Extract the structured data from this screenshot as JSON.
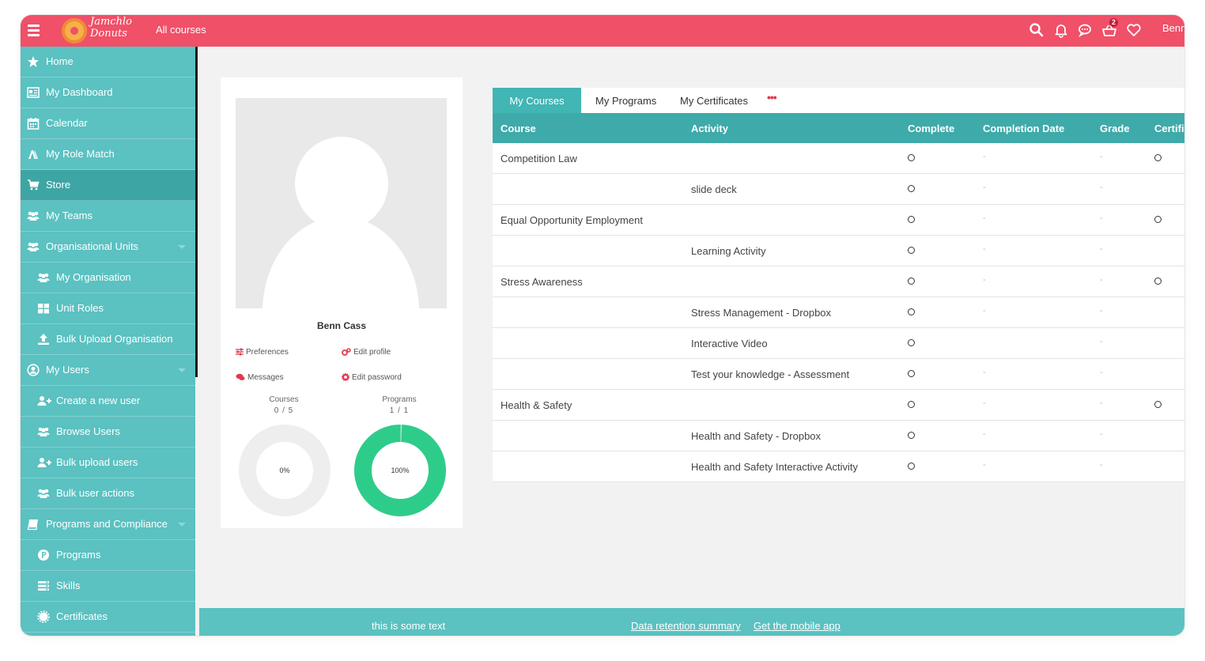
{
  "header": {
    "brand_line1": "Jamchlo",
    "brand_line2": "Donuts",
    "all_courses": "All courses",
    "cart_badge": "2",
    "user": "Benn"
  },
  "sidebar": {
    "items": [
      {
        "label": "Home",
        "icon": "star-icon"
      },
      {
        "label": "My Dashboard",
        "icon": "dashboard-icon"
      },
      {
        "label": "Calendar",
        "icon": "calendar-icon"
      },
      {
        "label": "My Role Match",
        "icon": "role-match-icon"
      },
      {
        "label": "Store",
        "icon": "cart-icon"
      },
      {
        "label": "My Teams",
        "icon": "users-icon"
      },
      {
        "label": "Organisational Units",
        "icon": "users-icon"
      },
      {
        "label": "My Organisation",
        "icon": "users-icon"
      },
      {
        "label": "Unit Roles",
        "icon": "grid-icon"
      },
      {
        "label": "Bulk Upload Organisation",
        "icon": "upload-icon"
      },
      {
        "label": "My Users",
        "icon": "user-circle-icon"
      },
      {
        "label": "Create a new user",
        "icon": "user-plus-icon"
      },
      {
        "label": "Browse Users",
        "icon": "users-icon"
      },
      {
        "label": "Bulk upload users",
        "icon": "user-plus-icon"
      },
      {
        "label": "Bulk user actions",
        "icon": "users-icon"
      },
      {
        "label": "Programs and Compliance",
        "icon": "book-icon"
      },
      {
        "label": "Programs",
        "icon": "p-circle-icon"
      },
      {
        "label": "Skills",
        "icon": "list-icon"
      },
      {
        "label": "Certificates",
        "icon": "certificate-icon"
      }
    ]
  },
  "profile": {
    "name": "Benn Cass",
    "preferences": "Preferences",
    "edit_profile": "Edit profile",
    "messages": "Messages",
    "edit_password": "Edit password",
    "courses_label": "Courses",
    "courses_value": "0 / 5",
    "courses_pct_label": "0%",
    "courses_fraction": 0,
    "programs_label": "Programs",
    "programs_value": "1 / 1",
    "programs_pct_label": "100%",
    "programs_fraction": 1,
    "color_progress": "#2ecc8a",
    "color_track": "#eeeeee"
  },
  "tabs": {
    "items": [
      "My Courses",
      "My Programs",
      "My Certificates"
    ],
    "more": "•••",
    "active": "My Courses"
  },
  "table": {
    "headers": [
      "Course",
      "Activity",
      "Complete",
      "Completion Date",
      "Grade",
      "Certificate"
    ],
    "rows": [
      {
        "course": "Competition Law",
        "activity": "",
        "date": "-",
        "grade": "-",
        "cert": true
      },
      {
        "course": "",
        "activity": "slide deck",
        "date": "-",
        "grade": "-",
        "cert": false
      },
      {
        "course": "Equal Opportunity Employment",
        "activity": "",
        "date": "-",
        "grade": "-",
        "cert": true
      },
      {
        "course": "",
        "activity": "Learning Activity",
        "date": "-",
        "grade": "-",
        "cert": false
      },
      {
        "course": "Stress Awareness",
        "activity": "",
        "date": "-",
        "grade": "-",
        "cert": true
      },
      {
        "course": "",
        "activity": "Stress Management - Dropbox",
        "date": "-",
        "grade": "-",
        "cert": false
      },
      {
        "course": "",
        "activity": "Interactive Video",
        "date": "",
        "grade": "-",
        "cert": false
      },
      {
        "course": "",
        "activity": "Test your knowledge - Assessment",
        "date": "-",
        "grade": "-",
        "cert": false
      },
      {
        "course": "Health & Safety",
        "activity": "",
        "date": "-",
        "grade": "-",
        "cert": true
      },
      {
        "course": "",
        "activity": "Health and Safety - Dropbox",
        "date": "-",
        "grade": "-",
        "cert": false
      },
      {
        "course": "",
        "activity": "Health and Safety Interactive Activity",
        "date": "-",
        "grade": "-",
        "cert": false
      }
    ]
  },
  "footer": {
    "text": "this is some text",
    "data_retention": "Data retention summary",
    "mobile_app": "Get the mobile app"
  },
  "colors": {
    "header": "#f05068",
    "sidebar": "#5bc1c1",
    "sidebar_active": "#3ea5a5",
    "table_header": "#3faaaa",
    "tab_active": "#42b5b5"
  }
}
